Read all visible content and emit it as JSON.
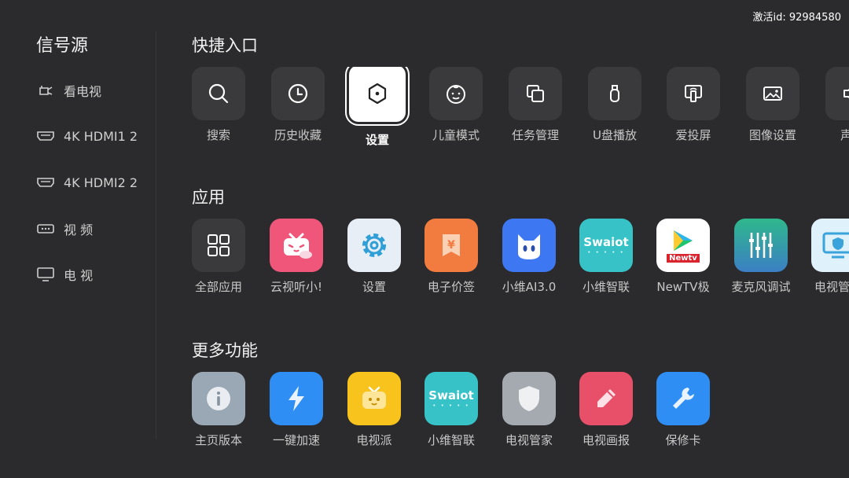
{
  "activation": "激活id: 92984580",
  "sidebar": {
    "title": "信号源",
    "items": [
      {
        "label": "看电视",
        "icon": "antenna-tv-icon"
      },
      {
        "label": "4K HDMI1 2",
        "icon": "hdmi-port-icon"
      },
      {
        "label": "4K HDMI2 2",
        "icon": "hdmi-port-icon"
      },
      {
        "label": "视  频",
        "icon": "av-port-icon"
      },
      {
        "label": "电  视",
        "icon": "monitor-icon"
      }
    ]
  },
  "quick": {
    "title": "快捷入口",
    "focused_index": 2,
    "items": [
      {
        "label": "搜索",
        "icon": "search-icon"
      },
      {
        "label": "历史收藏",
        "icon": "clock-icon"
      },
      {
        "label": "设置",
        "icon": "settings-hexagon-icon"
      },
      {
        "label": "儿童模式",
        "icon": "child-face-icon"
      },
      {
        "label": "任务管理",
        "icon": "windows-stack-icon"
      },
      {
        "label": "U盘播放",
        "icon": "usb-drive-icon"
      },
      {
        "label": "爱投屏",
        "icon": "screen-cast-icon"
      },
      {
        "label": "图像设置",
        "icon": "image-icon"
      },
      {
        "label": "声音",
        "icon": "speaker-icon"
      }
    ]
  },
  "apps": {
    "title": "应用",
    "items": [
      {
        "label": "全部应用",
        "icon": "grid-icon",
        "color": "#3a3a3c"
      },
      {
        "label": "云视听小!",
        "icon": "tv-mascot-icon",
        "color": "#f0557a"
      },
      {
        "label": "设置",
        "icon": "gear-icon",
        "color": "#e7eef5"
      },
      {
        "label": "电子价签",
        "icon": "price-tag-icon",
        "color": "#f27b3f"
      },
      {
        "label": "小维AI3.0",
        "icon": "cat-face-icon",
        "color": "#3d78f2"
      },
      {
        "label": "小维智联",
        "icon": "swaiot-logo-icon",
        "color": "#37c2c7",
        "logo": "Swaiot"
      },
      {
        "label": "NewTV极",
        "icon": "newtv-logo-icon",
        "color": "#ffffff",
        "logo": "Newtv"
      },
      {
        "label": "麦克风调试",
        "icon": "mixer-sliders-icon",
        "color": "#3aa96a"
      },
      {
        "label": "电视管家",
        "icon": "tv-shield-icon",
        "color": "#dff1fb"
      }
    ]
  },
  "more": {
    "title": "更多功能",
    "items": [
      {
        "label": "主页版本",
        "icon": "info-icon",
        "color": "#9aa7b4"
      },
      {
        "label": "一键加速",
        "icon": "lightning-icon",
        "color": "#2f8ef4"
      },
      {
        "label": "电视派",
        "icon": "tv-face-icon",
        "color": "#f7c31c"
      },
      {
        "label": "小维智联",
        "icon": "swaiot-logo-icon",
        "color": "#37c2c7",
        "logo": "Swaiot"
      },
      {
        "label": "电视管家",
        "icon": "shield-icon",
        "color": "#a5aab0"
      },
      {
        "label": "电视画报",
        "icon": "pencil-icon",
        "color": "#e8506a"
      },
      {
        "label": "保修卡",
        "icon": "wrench-icon",
        "color": "#2f8ef4"
      }
    ]
  }
}
